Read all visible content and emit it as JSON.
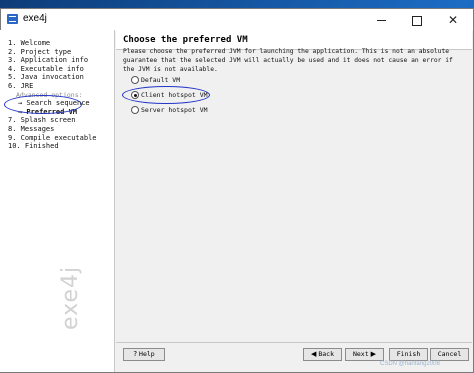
{
  "window": {
    "title": "exe4j"
  },
  "sidebar": {
    "steps": [
      {
        "label": "1. Welcome"
      },
      {
        "label": "2. Project type"
      },
      {
        "label": "3. Application info"
      },
      {
        "label": "4. Executable info"
      },
      {
        "label": "5. Java invocation"
      },
      {
        "label": "6. JRE"
      },
      {
        "label": "Advanced options:"
      },
      {
        "label": "→ Search sequence"
      },
      {
        "label": "→ Preferred VM"
      },
      {
        "label": "7. Splash screen"
      },
      {
        "label": "8. Messages"
      },
      {
        "label": "9. Compile executable"
      },
      {
        "label": "10. Finished"
      }
    ],
    "brand": "exe4j"
  },
  "main": {
    "title": "Choose the preferred VM",
    "description": "Please choose the preferred JVM for launching the application. This is not an absolute guarantee that the selected JVM will actually be used and it does not cause an error if the JVM is not available.",
    "options": [
      {
        "label": "Default VM",
        "selected": false
      },
      {
        "label": "Client hotspot VM",
        "selected": true
      },
      {
        "label": "Server hotspot VM",
        "selected": false
      }
    ]
  },
  "footer": {
    "help": "Help",
    "back": "Back",
    "next": "Next",
    "finish": "Finish",
    "cancel": "Cancel"
  },
  "watermark": "CSDN @hanfang2008"
}
